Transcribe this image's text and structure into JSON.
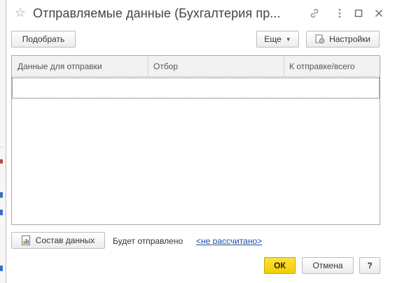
{
  "window": {
    "title": "Отправляемые данные (Бухгалтерия пр..."
  },
  "toolbar": {
    "select_label": "Подобрать",
    "more_label": "Еще",
    "settings_label": "Настройки"
  },
  "table": {
    "columns": [
      "Данные для отправки",
      "Отбор",
      "К отправке/всего"
    ],
    "rows": []
  },
  "footer": {
    "data_composition_label": "Состав данных",
    "will_be_sent_label": "Будет отправлено",
    "not_calculated_link": "<не рассчитано>",
    "ok_label": "ОК",
    "cancel_label": "Отмена",
    "help_label": "?"
  },
  "colors": {
    "accent_ok": "#f4d10d",
    "link": "#1a4fa3"
  },
  "icons": {
    "favorite": "star-icon",
    "link": "link-icon",
    "more": "more-vertical-icon",
    "maximize": "maximize-icon",
    "close": "close-icon",
    "settings": "gear-icon",
    "report": "report-icon"
  }
}
